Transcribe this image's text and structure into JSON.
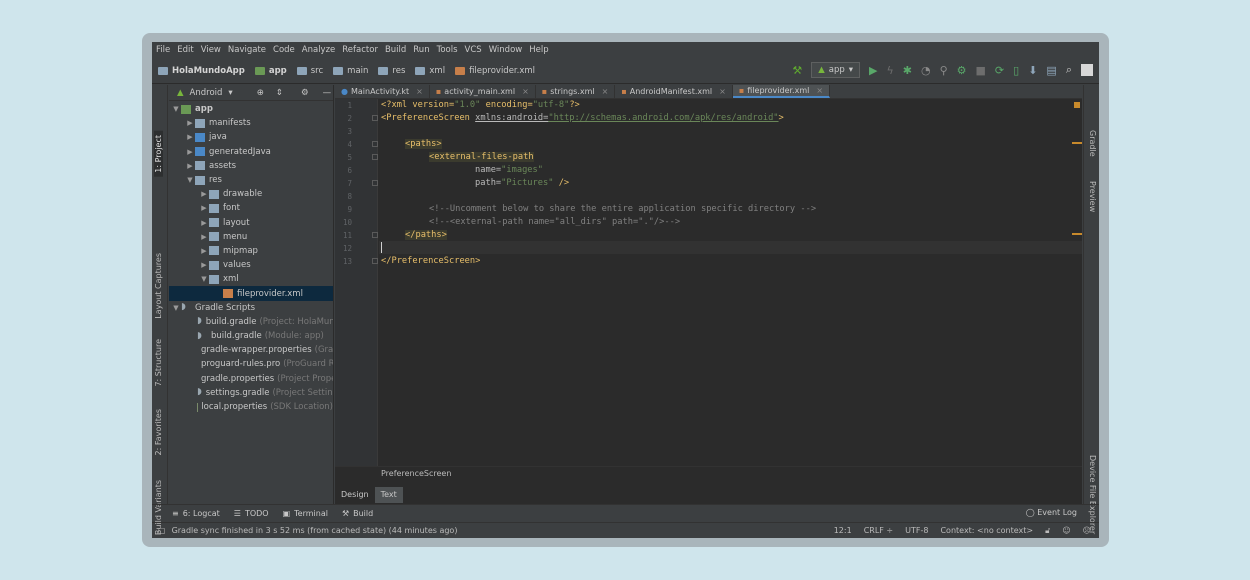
{
  "menu": [
    "File",
    "Edit",
    "View",
    "Navigate",
    "Code",
    "Analyze",
    "Refactor",
    "Build",
    "Run",
    "Tools",
    "VCS",
    "Window",
    "Help"
  ],
  "breadcrumbs": [
    "HolaMundoApp",
    "app",
    "src",
    "main",
    "res",
    "xml",
    "fileprovider.xml"
  ],
  "run_config": "app",
  "left_tools": {
    "project": "1: Project",
    "layout_captures": "Layout Captures",
    "structure": "7: Structure",
    "favorites": "2: Favorites",
    "build_variants": "Build Variants"
  },
  "right_tools": {
    "gradle": "Gradle",
    "preview": "Preview",
    "device_explorer": "Device File Explorer"
  },
  "project_panel": {
    "view": "Android"
  },
  "tree": [
    {
      "label": "app",
      "hint": ""
    },
    {
      "label": "manifests",
      "hint": ""
    },
    {
      "label": "java",
      "hint": ""
    },
    {
      "label": "generatedJava",
      "hint": ""
    },
    {
      "label": "assets",
      "hint": ""
    },
    {
      "label": "res",
      "hint": ""
    },
    {
      "label": "drawable",
      "hint": ""
    },
    {
      "label": "font",
      "hint": ""
    },
    {
      "label": "layout",
      "hint": ""
    },
    {
      "label": "menu",
      "hint": ""
    },
    {
      "label": "mipmap",
      "hint": ""
    },
    {
      "label": "values",
      "hint": ""
    },
    {
      "label": "xml",
      "hint": ""
    },
    {
      "label": "fileprovider.xml",
      "hint": ""
    },
    {
      "label": "Gradle Scripts",
      "hint": ""
    },
    {
      "label": "build.gradle",
      "hint": "(Project: HolaMundoA"
    },
    {
      "label": "build.gradle",
      "hint": "(Module: app)"
    },
    {
      "label": "gradle-wrapper.properties",
      "hint": "(Gradle"
    },
    {
      "label": "proguard-rules.pro",
      "hint": "(ProGuard Rul"
    },
    {
      "label": "gradle.properties",
      "hint": "(Project Propert"
    },
    {
      "label": "settings.gradle",
      "hint": "(Project Settings)"
    },
    {
      "label": "local.properties",
      "hint": "(SDK Location)"
    }
  ],
  "tabs": [
    "MainActivity.kt",
    "activity_main.xml",
    "strings.xml",
    "AndroidManifest.xml",
    "fileprovider.xml"
  ],
  "line_numbers": [
    "1",
    "2",
    "3",
    "4",
    "5",
    "6",
    "7",
    "8",
    "9",
    "10",
    "11",
    "12",
    "13"
  ],
  "code": {
    "l1a": "<?xml version=",
    "l1b": "\"1.0\"",
    "l1c": " encoding=",
    "l1d": "\"utf-8\"",
    "l1e": "?>",
    "l2a": "<PreferenceScreen ",
    "l2b": "xmlns:android=",
    "l2c": "\"http://schemas.android.com/apk/res/android\"",
    "l2d": ">",
    "l4": "<paths>",
    "l5": "<external-files-path",
    "l6a": "name=",
    "l6b": "\"images\"",
    "l7a": "path=",
    "l7b": "\"Pictures\"",
    "l7c": " />",
    "l9": "<!--Uncomment below to share the entire application specific directory -->",
    "l10": "<!--<external-path name=\"all_dirs\" path=\".\"/>-->",
    "l11": "</paths>",
    "l13": "</PreferenceScreen>"
  },
  "editor_breadcrumb": "PreferenceScreen",
  "design_tabs": {
    "design": "Design",
    "text": "Text"
  },
  "bottom_tools": {
    "logcat": "6: Logcat",
    "todo": "TODO",
    "terminal": "Terminal",
    "build": "Build",
    "event_log": "Event Log"
  },
  "status": {
    "message": "Gradle sync finished in 3 s 52 ms (from cached state) (44 minutes ago)",
    "position": "12:1",
    "line_sep": "CRLF ÷",
    "encoding": "UTF-8",
    "context": "Context: <no context>"
  }
}
